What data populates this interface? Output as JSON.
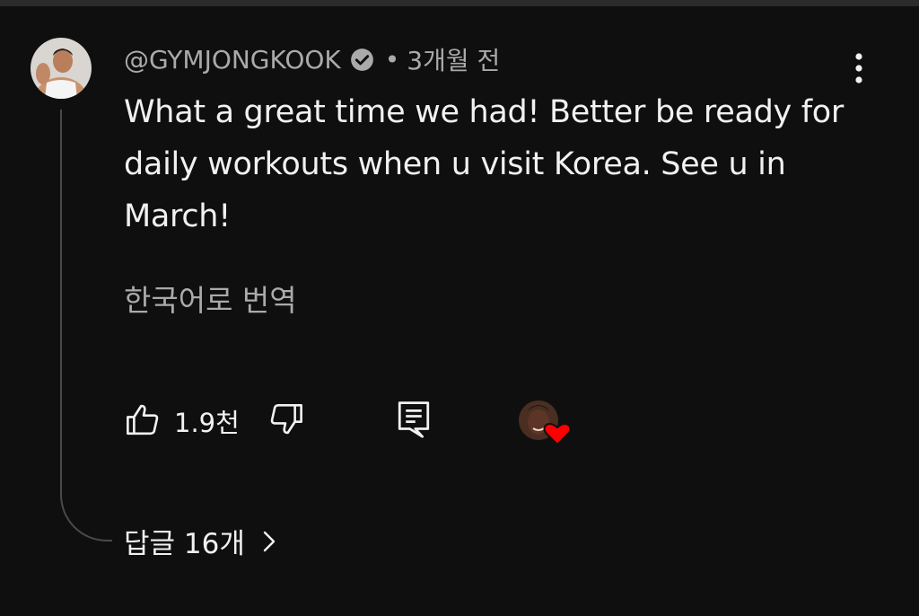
{
  "comment": {
    "author": "@GYMJONGKOOK",
    "separator": "•",
    "time": "3개월 전",
    "text": "What a great time we had! Better be ready for daily workouts when u visit Korea. See u in March!",
    "translate_label": "한국어로 번역",
    "like_count": "1.9천",
    "replies_label": "답글 16개"
  },
  "icons": {
    "verified": "verified-check-icon",
    "more": "more-vert-icon",
    "like": "thumb-up-icon",
    "dislike": "thumb-down-icon",
    "reply": "reply-comment-icon",
    "creator_heart": "creator-heart-icon",
    "chevron": "chevron-right-icon"
  },
  "colors": {
    "background": "#0f0f0f",
    "primary_text": "#f1f1f1",
    "secondary_text": "#aaaaaa",
    "heart": "#ff0000"
  }
}
